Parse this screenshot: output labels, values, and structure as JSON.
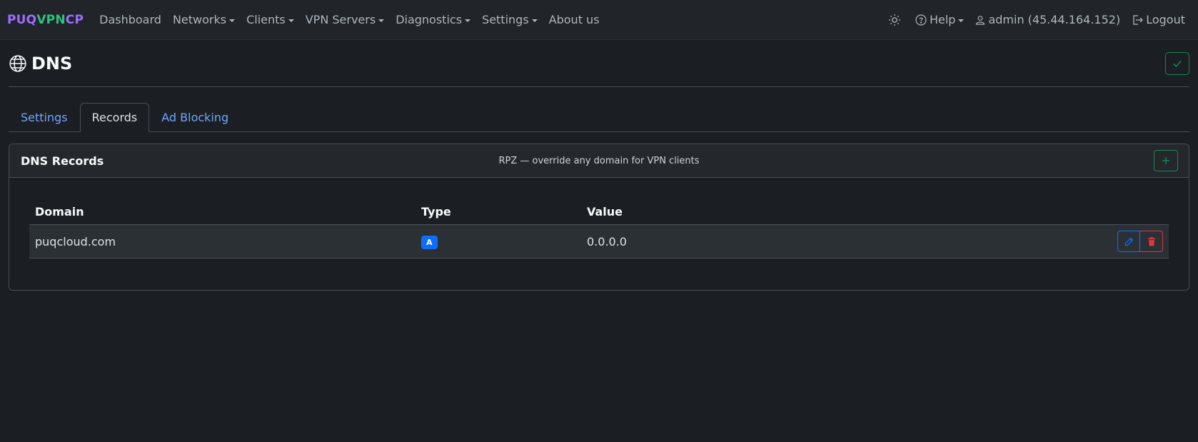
{
  "brand": {
    "part1": "PUQ",
    "part2": "VPN",
    "part3": "CP"
  },
  "nav": {
    "dashboard": "Dashboard",
    "networks": "Networks",
    "clients": "Clients",
    "vpn_servers": "VPN Servers",
    "diagnostics": "Diagnostics",
    "settings": "Settings",
    "about": "About us",
    "help": "Help",
    "user": "admin (45.44.164.152)",
    "logout": "Logout"
  },
  "page": {
    "title": "DNS"
  },
  "tabs": [
    {
      "label": "Settings"
    },
    {
      "label": "Records"
    },
    {
      "label": "Ad Blocking"
    }
  ],
  "card": {
    "title": "DNS Records",
    "subtitle": "RPZ — override any domain for VPN clients"
  },
  "table": {
    "headers": [
      "Domain",
      "Type",
      "Value"
    ],
    "rows": [
      {
        "domain": "puqcloud.com",
        "type": "A",
        "value": "0.0.0.0"
      }
    ]
  },
  "colors": {
    "accent": "#0d6efd",
    "success": "#198754",
    "danger": "#dc3545",
    "link": "#6ea8fe"
  }
}
